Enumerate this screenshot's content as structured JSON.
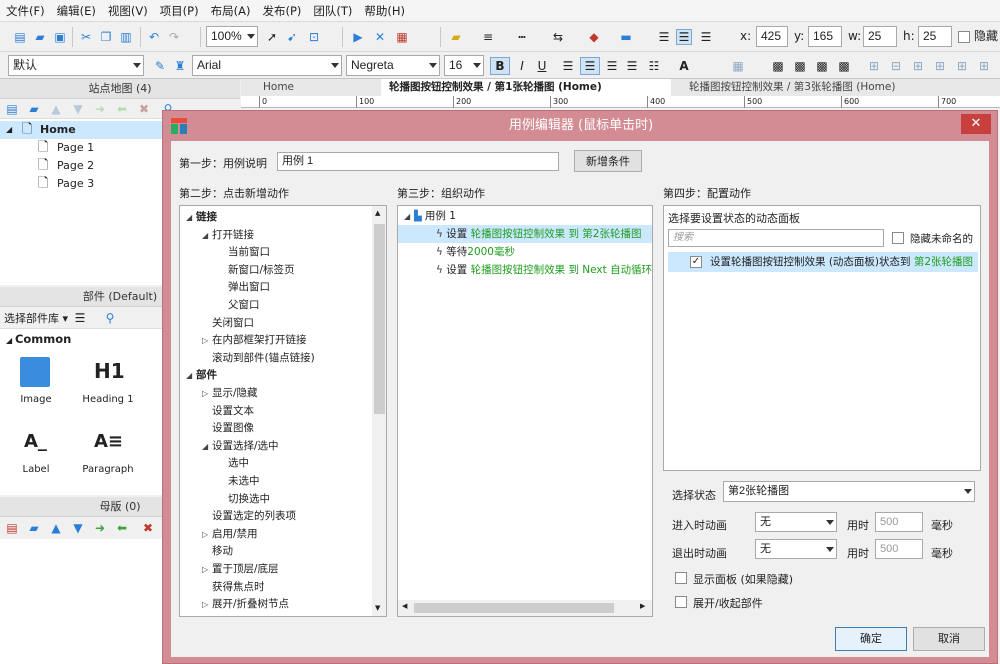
{
  "menubar": {
    "items": [
      "文件(F)",
      "编辑(E)",
      "视图(V)",
      "项目(P)",
      "布局(A)",
      "发布(P)",
      "团队(T)",
      "帮助(H)"
    ]
  },
  "toolbar": {
    "zoom": "100%",
    "x_label": "x:",
    "x": "425",
    "y_label": "y:",
    "y": "165",
    "w_label": "w:",
    "w": "25",
    "h_label": "h:",
    "h": "25",
    "hidden_label": "隐藏"
  },
  "format": {
    "style": "默认",
    "font": "Arial",
    "weight": "Negreta",
    "size": "16",
    "bold": "B",
    "italic": "I",
    "underline": "U",
    "color_a": "A"
  },
  "sitemap": {
    "title": "站点地图 (4)",
    "home": "Home",
    "pages": [
      "Page 1",
      "Page 2",
      "Page 3"
    ]
  },
  "widgets": {
    "title": "部件 (Default)",
    "library_label": "选择部件库",
    "group": "Common",
    "items": [
      {
        "icon": "H1",
        "label": "Heading 1"
      },
      {
        "icon": "A_",
        "label": "Label"
      },
      {
        "icon": "A≡",
        "label": "Paragraph"
      }
    ],
    "image_label": "Image"
  },
  "masters": {
    "title": "母版 (0)"
  },
  "tabs": [
    "Home",
    "轮播图按钮控制效果 / 第1张轮播图 (Home)",
    "轮播图按钮控制效果 / 第3张轮播图 (Home)"
  ],
  "ruler": [
    "0",
    "100",
    "200",
    "300",
    "400",
    "500",
    "600",
    "700"
  ],
  "dialog": {
    "title": "用例编辑器 (鼠标单击时)",
    "step1_label": "第一步：用例说明",
    "case_name": "用例 1",
    "add_condition": "新增条件",
    "step2_label": "第二步：点击新增动作",
    "step3_label": "第三步：组织动作",
    "step4_label": "第四步：配置动作",
    "actions": [
      {
        "t": "链接",
        "l": 0,
        "bold": true,
        "exp": "◢"
      },
      {
        "t": "打开链接",
        "l": 1,
        "exp": "◢"
      },
      {
        "t": "当前窗口",
        "l": 2
      },
      {
        "t": "新窗口/标签页",
        "l": 2
      },
      {
        "t": "弹出窗口",
        "l": 2
      },
      {
        "t": "父窗口",
        "l": 2
      },
      {
        "t": "关闭窗口",
        "l": 1
      },
      {
        "t": "在内部框架打开链接",
        "l": 1,
        "exp": "▷"
      },
      {
        "t": "滚动到部件(锚点链接)",
        "l": 1
      },
      {
        "t": "部件",
        "l": 0,
        "bold": true,
        "exp": "◢"
      },
      {
        "t": "显示/隐藏",
        "l": 1,
        "exp": "▷"
      },
      {
        "t": "设置文本",
        "l": 1
      },
      {
        "t": "设置图像",
        "l": 1
      },
      {
        "t": "设置选择/选中",
        "l": 1,
        "exp": "◢"
      },
      {
        "t": "选中",
        "l": 2
      },
      {
        "t": "未选中",
        "l": 2
      },
      {
        "t": "切换选中",
        "l": 2
      },
      {
        "t": "设置选定的列表项",
        "l": 1
      },
      {
        "t": "启用/禁用",
        "l": 1,
        "exp": "▷"
      },
      {
        "t": "移动",
        "l": 1
      },
      {
        "t": "置于顶层/底层",
        "l": 1,
        "exp": "▷"
      },
      {
        "t": "获得焦点时",
        "l": 1
      },
      {
        "t": "展开/折叠树节点",
        "l": 1,
        "exp": "▷"
      }
    ],
    "case_root": "用例 1",
    "steps": [
      {
        "pre": "设置 ",
        "val": "轮播图按钮控制效果 到 第2张轮播图"
      },
      {
        "pre": "等待",
        "val": "2000毫秒"
      },
      {
        "pre": "设置 ",
        "val": "轮播图按钮控制效果 到 Next 自动循环"
      }
    ],
    "panel_label": "选择要设置状态的动态面板",
    "search_placeholder": "搜索",
    "hide_unnamed": "隐藏未命名的",
    "panel_item_pre": "设置轮播图按钮控制效果 (动态面板)状态到 ",
    "panel_item_val": "第2张轮播图",
    "state_label": "选择状态",
    "state_value": "第2张轮播图",
    "enter_anim_label": "进入时动画",
    "enter_anim": "无",
    "enter_time_label": "用时",
    "enter_time": "500",
    "enter_unit": "毫秒",
    "exit_anim_label": "退出时动画",
    "exit_anim": "无",
    "exit_time_label": "用时",
    "exit_time": "500",
    "exit_unit": "毫秒",
    "show_panel": "显示面板 (如果隐藏)",
    "expand_widgets": "展开/收起部件",
    "ok": "确定",
    "cancel": "取消"
  },
  "colors": {
    "accent": "#2a7fd4",
    "title_bar": "#d38c93",
    "close": "#c7403d",
    "selection": "#cce8ff",
    "green": "#1f9d1f"
  }
}
